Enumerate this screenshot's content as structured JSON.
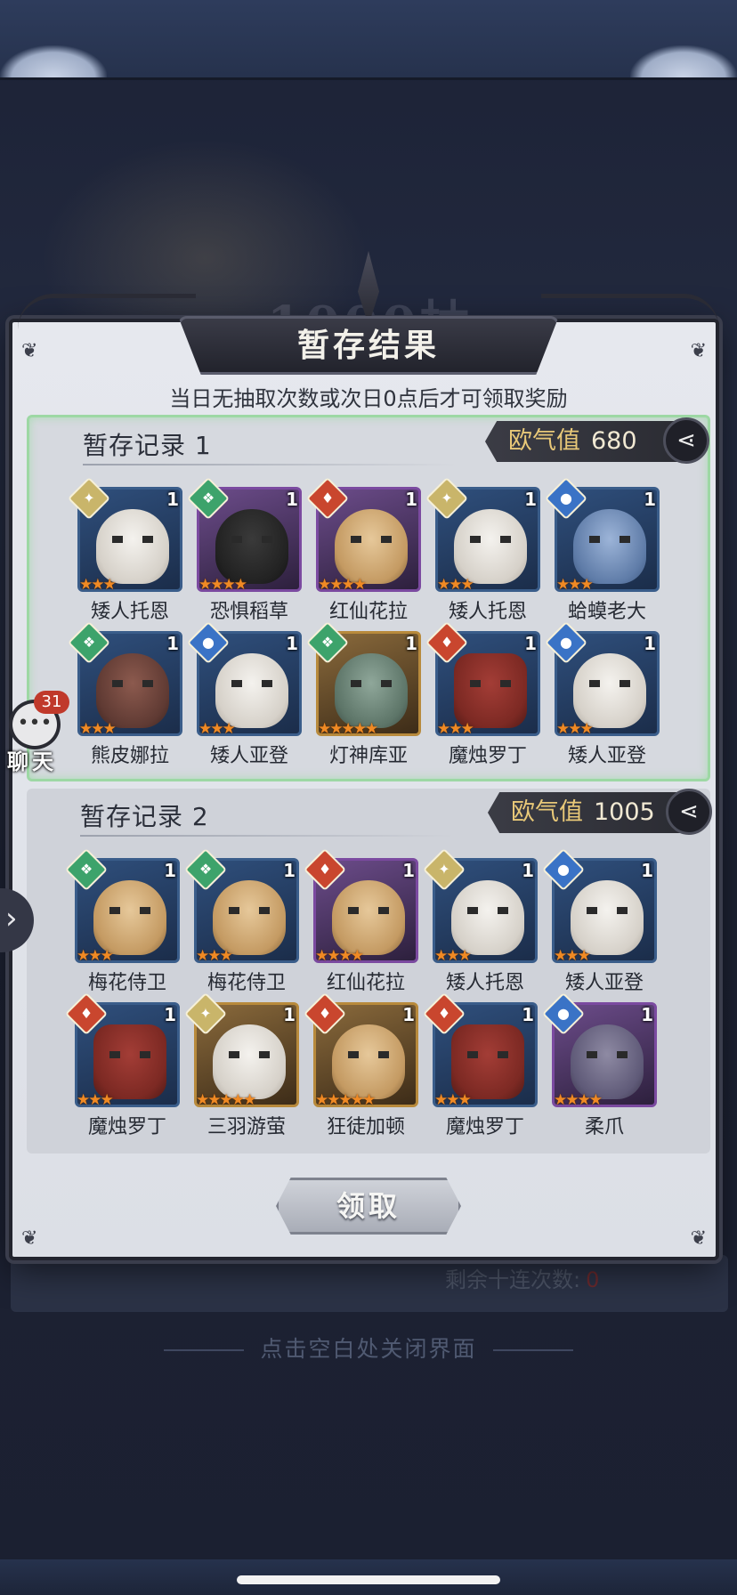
{
  "background": {
    "banner_text": "1000抽",
    "remaining_label": "剩余十连次数:",
    "remaining_value": "0",
    "close_hint": "点击空白处关闭界面"
  },
  "dialog": {
    "title": "暂存结果",
    "hint": "当日无抽取次数或次日0点后才可领取奖励",
    "claim_label": "领取"
  },
  "records": [
    {
      "title": "暂存记录 1",
      "luck_label": "欧气值",
      "luck_value": "680",
      "heroes": [
        {
          "name": "矮人托恩",
          "count": "1",
          "stars": 3,
          "element": "light"
        },
        {
          "name": "恐惧稻草",
          "count": "1",
          "stars": 4,
          "element": "dark"
        },
        {
          "name": "红仙花拉",
          "count": "1",
          "stars": 4,
          "element": "fire"
        },
        {
          "name": "矮人托恩",
          "count": "1",
          "stars": 3,
          "element": "light"
        },
        {
          "name": "蛤蟆老大",
          "count": "1",
          "stars": 3,
          "element": "water"
        },
        {
          "name": "熊皮娜拉",
          "count": "1",
          "stars": 3,
          "element": "dark"
        },
        {
          "name": "矮人亚登",
          "count": "1",
          "stars": 3,
          "element": "water"
        },
        {
          "name": "灯神库亚",
          "count": "1",
          "stars": 5,
          "element": "dark"
        },
        {
          "name": "魔烛罗丁",
          "count": "1",
          "stars": 3,
          "element": "fire"
        },
        {
          "name": "矮人亚登",
          "count": "1",
          "stars": 3,
          "element": "water"
        }
      ]
    },
    {
      "title": "暂存记录 2",
      "luck_label": "欧气值",
      "luck_value": "1005",
      "heroes": [
        {
          "name": "梅花侍卫",
          "count": "1",
          "stars": 3,
          "element": "dark"
        },
        {
          "name": "梅花侍卫",
          "count": "1",
          "stars": 3,
          "element": "dark"
        },
        {
          "name": "红仙花拉",
          "count": "1",
          "stars": 4,
          "element": "fire"
        },
        {
          "name": "矮人托恩",
          "count": "1",
          "stars": 3,
          "element": "light"
        },
        {
          "name": "矮人亚登",
          "count": "1",
          "stars": 3,
          "element": "water"
        },
        {
          "name": "魔烛罗丁",
          "count": "1",
          "stars": 3,
          "element": "fire"
        },
        {
          "name": "三羽游萤",
          "count": "1",
          "stars": 5,
          "element": "light"
        },
        {
          "name": "狂徒加顿",
          "count": "1",
          "stars": 5,
          "element": "fire"
        },
        {
          "name": "魔烛罗丁",
          "count": "1",
          "stars": 3,
          "element": "fire"
        },
        {
          "name": "柔爪",
          "count": "1",
          "stars": 4,
          "element": "water"
        }
      ]
    }
  ],
  "chat": {
    "badge": "31",
    "label": "聊天"
  },
  "icons": {
    "share": "share-icon",
    "side_arrow": "chevron-right-icon",
    "chat": "chat-bubble-icon"
  },
  "colors": {
    "star": "#f08a24",
    "active_record_border": "#9dd8a4",
    "luck_label": "#e8c878",
    "chat_badge": "#c0392b"
  }
}
